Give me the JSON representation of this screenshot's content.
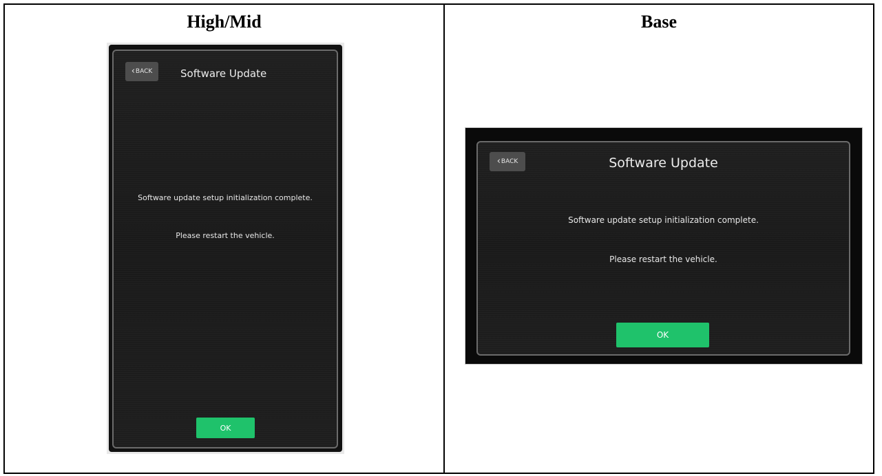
{
  "table": {
    "columns": [
      {
        "heading": "High/Mid",
        "screen": {
          "back_label": "BACK",
          "back_chevron": "‹",
          "title": "Software Update",
          "message_line1": "Software update setup initialization complete.",
          "message_line2": "Please restart the vehicle.",
          "ok_label": "OK"
        }
      },
      {
        "heading": "Base",
        "screen": {
          "back_label": "BACK",
          "back_chevron": "‹",
          "title": "Software Update",
          "message_line1": "Software update setup initialization complete.",
          "message_line2": "Please restart the vehicle.",
          "ok_label": "OK"
        }
      }
    ]
  },
  "colors": {
    "ok_button": "#1fc26b",
    "screen_background": "#1c1c1c",
    "back_button": "#4d4d4d"
  }
}
